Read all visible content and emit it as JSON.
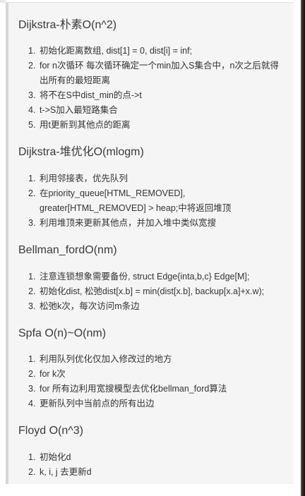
{
  "sections": [
    {
      "title": "Dijkstra-朴素O(n^2)",
      "items": [
        {
          "num": "1.",
          "text": "初始化距离数组, dist[1] = 0, dist[i] = inf;"
        },
        {
          "num": "2.",
          "text": "for n次循环 每次循环确定一个min加入S集合中，n次之后就得出所有的最短距离"
        },
        {
          "num": "3.",
          "text": "将不在S中dist_min的点->t"
        },
        {
          "num": "4.",
          "text": "t->S加入最短路集合"
        },
        {
          "num": "5.",
          "text": "用t更新到其他点的距离"
        }
      ]
    },
    {
      "title": "Dijkstra-堆优化O(mlogm)",
      "items": [
        {
          "num": "1.",
          "text": "利用邻接表，优先队列"
        },
        {
          "num": "2.",
          "text": "在priority_queue[HTML_REMOVED], greater[HTML_REMOVED] > heap;中将返回堆顶"
        },
        {
          "num": "3.",
          "text": "利用堆顶来更新其他点，并加入堆中类似宽搜"
        }
      ]
    },
    {
      "title": "Bellman_fordO(nm)",
      "items": [
        {
          "num": "1.",
          "text": "注意连锁想象需要备份, struct Edge{inta,b,c} Edge[M];"
        },
        {
          "num": "2.",
          "text": "初始化dist, 松弛dist[x.b] = min(dist[x.b], backup[x.a]+x.w);"
        },
        {
          "num": "3.",
          "text": "松弛k次，每次访问m条边"
        }
      ]
    },
    {
      "title": "Spfa O(n)~O(nm)",
      "items": [
        {
          "num": "1.",
          "text": "利用队列优化仅加入修改过的地方"
        },
        {
          "num": "2.",
          "text": "for k次"
        },
        {
          "num": "3.",
          "text": "for 所有边利用宽搜模型去优化bellman_ford算法"
        },
        {
          "num": "4.",
          "text": "更新队列中当前点的所有出边"
        }
      ]
    },
    {
      "title": "Floyd O(n^3)",
      "items": [
        {
          "num": "1.",
          "text": "初始化d"
        },
        {
          "num": "2.",
          "text": "k, i, j 去更新d"
        }
      ]
    }
  ]
}
